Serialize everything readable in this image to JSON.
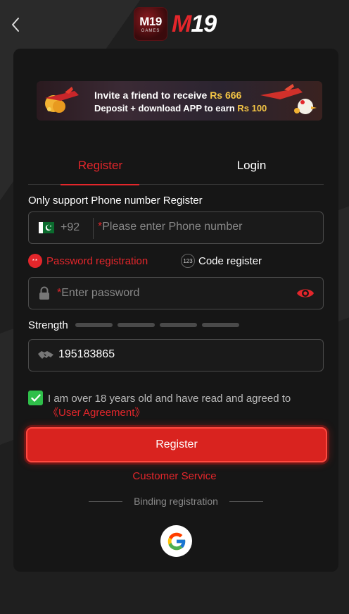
{
  "header": {
    "logo_badge_line1": "M19",
    "logo_badge_line2": "GAMES",
    "logo_text_m": "M",
    "logo_text_19": "19"
  },
  "banner": {
    "line1_prefix": "Invite a friend to receive",
    "line1_amount": "Rs 666",
    "line2_prefix": "Deposit + download APP to earn",
    "line2_amount": "Rs 100"
  },
  "tabs": {
    "register": "Register",
    "login": "Login",
    "active": "register"
  },
  "form": {
    "hint": "Only support Phone number Register",
    "country_code": "+92",
    "country_flag": "pakistan-flag",
    "required_mark": "*",
    "phone_placeholder": "Please enter Phone number",
    "phone_value": "",
    "mode_password_label": "Password registration",
    "mode_password_icon": "**",
    "mode_code_label": "Code register",
    "mode_code_icon": "123",
    "mode_active": "password",
    "password_placeholder": "Enter password",
    "password_value": "",
    "strength_label": "Strength",
    "strength_level": 0,
    "invite_code_value": "195183865",
    "agree_checked": true,
    "agree_text": "I am over 18 years old and have read and agreed to",
    "agree_link": "《User Agreement》",
    "register_button": "Register"
  },
  "footer": {
    "customer_service": "Customer Service",
    "binding_label": "Binding registration",
    "google_icon": "google-icon"
  },
  "colors": {
    "accent": "#e3262b",
    "button": "#d9231f",
    "checkbox": "#2fbf4a",
    "card": "#161616",
    "background": "#1e1e1e"
  }
}
